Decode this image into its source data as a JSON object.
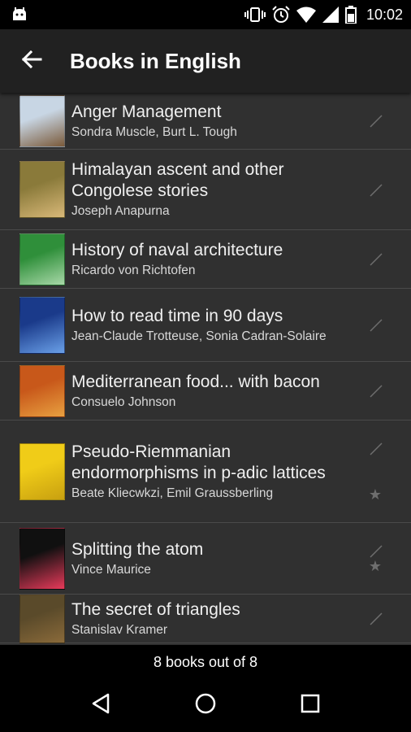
{
  "status_bar": {
    "time": "10:02",
    "icons": [
      "android-debug-icon",
      "vibrate-icon",
      "alarm-icon",
      "wifi-icon",
      "signal-icon",
      "battery-icon"
    ]
  },
  "app_bar": {
    "title": "Books in English",
    "back_icon": "arrow-back-icon"
  },
  "books": [
    {
      "title": "Anger Management",
      "authors": "Sondra Muscle, Burt L. Tough",
      "starred": false,
      "cover_colors": [
        "#c8d6e4",
        "#7a5a3a"
      ]
    },
    {
      "title": "Himalayan ascent and other Congolese stories",
      "authors": "Joseph Anapurna",
      "starred": false,
      "cover_colors": [
        "#8a7a3a",
        "#d8b878"
      ]
    },
    {
      "title": "History of naval architecture",
      "authors": "Ricardo von Richtofen",
      "starred": false,
      "cover_colors": [
        "#2f8f3a",
        "#a8d8a8"
      ]
    },
    {
      "title": "How to read time in 90 days",
      "authors": "Jean-Claude Trotteuse, Sonia Cadran-Solaire",
      "starred": false,
      "cover_colors": [
        "#1a3a8a",
        "#6aa0e8"
      ]
    },
    {
      "title": "Mediterranean food... with bacon",
      "authors": "Consuelo Johnson",
      "starred": false,
      "cover_colors": [
        "#c8581a",
        "#e8a040"
      ]
    },
    {
      "title": "Pseudo-Riemmanian endormorphisms in p-adic lattices",
      "authors": "Beate Kliecwkzi, Emil Graussberling",
      "starred": true,
      "cover_colors": [
        "#f0cc18",
        "#c8a010"
      ]
    },
    {
      "title": "Splitting the atom",
      "authors": "Vince Maurice",
      "starred": true,
      "cover_colors": [
        "#101010",
        "#e83a5a"
      ]
    },
    {
      "title": "The secret of triangles",
      "authors": "Stanislav Kramer",
      "starred": false,
      "cover_colors": [
        "#5a4a2a",
        "#8a6a3a"
      ]
    }
  ],
  "footer": {
    "count_text": "8 books out of 8"
  },
  "nav_bar": {
    "buttons": [
      "back-triangle-icon",
      "home-circle-icon",
      "recents-square-icon"
    ]
  },
  "colors": {
    "app_bar_bg": "#212121",
    "list_bg": "#303030",
    "divider": "#4a4a4a"
  }
}
